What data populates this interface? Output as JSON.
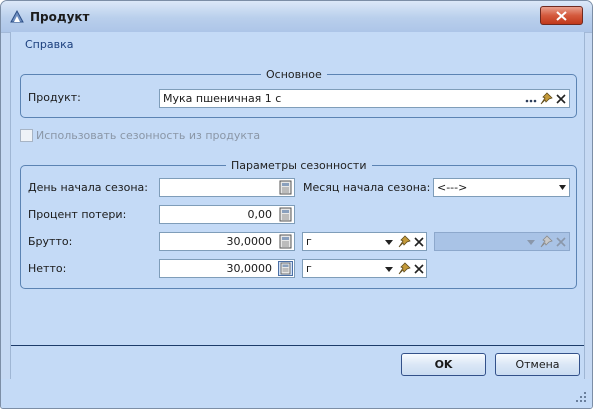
{
  "window": {
    "title": "Продукт"
  },
  "menu": {
    "help": "Справка"
  },
  "main_group": {
    "title": "Основное",
    "product_label": "Продукт:",
    "product_value": "Мука пшеничная 1 с"
  },
  "season_checkbox": {
    "label": "Использовать сезонность из продукта",
    "checked": false,
    "enabled": false
  },
  "season_group": {
    "title": "Параметры сезонности",
    "start_day_label": "День начала сезона:",
    "start_day_value": "",
    "start_month_label": "Месяц начала сезона:",
    "start_month_value": "<--->",
    "loss_label": "Процент потери:",
    "loss_value": "0,00",
    "gross_label": "Брутто:",
    "gross_value": "30,0000",
    "gross_unit": "г",
    "gross_unit2": "",
    "net_label": "Нетто:",
    "net_value": "30,0000",
    "net_unit": "г"
  },
  "buttons": {
    "ok": "OK",
    "cancel": "Отмена"
  },
  "colors": {
    "accent": "#33518a",
    "background": "#c4daf6",
    "close": "#c1391b"
  }
}
